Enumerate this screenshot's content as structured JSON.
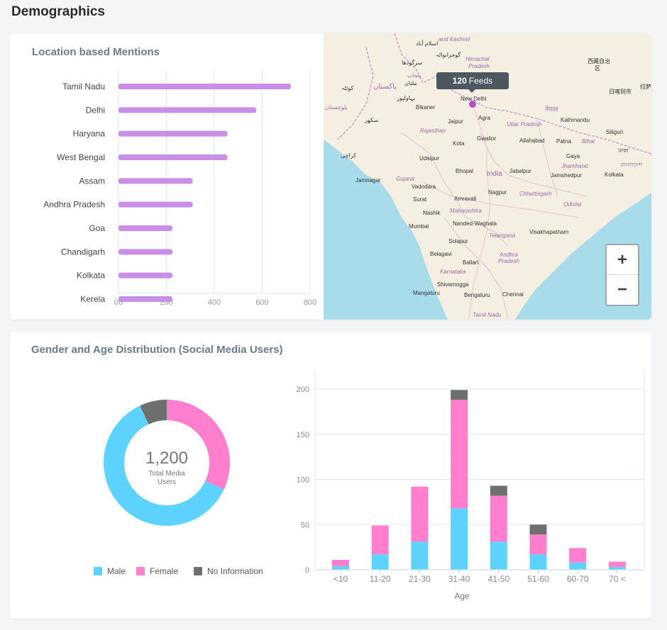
{
  "page": {
    "title": "Demographics"
  },
  "location_card": {
    "title": "Location based Mentions",
    "chart_data": {
      "type": "bar",
      "orientation": "horizontal",
      "categories": [
        "Tamil Nadu",
        "Delhi",
        "Haryana",
        "West Bengal",
        "Assam",
        "Andhra Pradesh",
        "Goa",
        "Chandigarh",
        "Kolkata",
        "Kerela"
      ],
      "values": [
        720,
        575,
        455,
        455,
        310,
        310,
        225,
        225,
        225,
        225
      ],
      "xlim": [
        0,
        800
      ],
      "xticks": [
        "00",
        "200",
        "400",
        "600",
        "800"
      ],
      "bar_color": "#c98ee8",
      "grid": true
    }
  },
  "map": {
    "tooltip_value": "120",
    "tooltip_label": "Feeds",
    "zoom_in_label": "+",
    "zoom_out_label": "−",
    "labels": {
      "new_delhi": "New Delhi",
      "bikaner": "Bikaner",
      "jaipur": "Jaipur",
      "agra": "Agra",
      "uttar_pradesh": "Uttar Pradesh",
      "kathmandu": "Kathmandu",
      "nepal": "नेपाल",
      "siliguri": "Siliguri",
      "rajasthan": "Rajasthan",
      "kota": "Kota",
      "gwalior": "Gwalior",
      "allahabad": "Allahabad",
      "patna": "Patna",
      "bihar": "Bihar",
      "udaipur": "Udaipur",
      "bhopal": "Bhopal",
      "india": "India",
      "jabalpur": "Jabalpur",
      "jamshedpur": "Jamshedpur",
      "kolkata": "Kolkata",
      "jamnagar": "Jamnagar",
      "gujarat": "Gujarat",
      "vadodara": "Vadodara",
      "surat": "Surat",
      "amravati": "Amravati",
      "nagpur": "Nagpur",
      "chhattisgarh": "Chhattisgarh",
      "odisha": "Odisha",
      "nashik": "Nashik",
      "maharashtra": "Maharashtra",
      "mumbai": "Mumbai",
      "nanded": "Nanded-Waghala",
      "telangana": "Telangana",
      "visakhapatnam": "Visakhapatnam",
      "solapur": "Solapur",
      "belagavi": "Belagavi",
      "andhra": "Andhra",
      "pradesh": "Pradesh",
      "ballari": "Ballari",
      "karnataka": "Karnataka",
      "shivamogga": "Shivamogga",
      "mangaluru": "Mangaluru",
      "bengaluru": "Bengaluru",
      "chennai": "Chennai",
      "tamil_nadu": "Tamil Nadu",
      "gaya": "Gaya",
      "jharkhand": "Jharkhand",
      "jammu_kashmir": "and Kashmir",
      "himachal": "Himachal",
      "pradesh2": "Pradesh",
      "xizang": "西藏自治",
      "xizang2": "区",
      "nihon": "日喀则市",
      "lasa": "拉萨",
      "pakistan": "پاکستان",
      "punjab": "پنجاب",
      "islamabad": "اسلام آباد",
      "sargodha": "سرگودھا",
      "multan": "ملتان",
      "quetta": "کوئٹہ",
      "bahawalpur": "بہاولپور",
      "balochistan": "بلوچستان",
      "sukkur": "سکھر",
      "karachi": "کراچی",
      "gujranwala": "گوجرانوالہ",
      "bangladesh": "বাংলাদেশ",
      "nepali2": "ঢাকা"
    }
  },
  "gender_card": {
    "title": "Gender and Age Distribution (Social Media Users)",
    "donut": {
      "total": "1,200",
      "total_label_line1": "Total Media",
      "total_label_line2": "Users",
      "chart_data": {
        "type": "pie",
        "slices": [
          {
            "name": "Male",
            "value": 61,
            "color": "#5fd3ff"
          },
          {
            "name": "Female",
            "value": 32,
            "color": "#ff7fcc"
          },
          {
            "name": "No Information",
            "value": 7,
            "color": "#6f6f6f"
          }
        ]
      }
    },
    "legend": [
      {
        "label": "Male",
        "color": "#5fd3ff"
      },
      {
        "label": "Female",
        "color": "#ff7fcc"
      },
      {
        "label": "No Information",
        "color": "#6f6f6f"
      }
    ],
    "chart_data": {
      "type": "bar",
      "stacked": true,
      "categories": [
        "<10",
        "11-20",
        "21-30",
        "31-40",
        "41-50",
        "51-60",
        "60-70",
        "70 <"
      ],
      "series": [
        {
          "name": "Male",
          "color": "#5fd3ff",
          "values": [
            4,
            17,
            31,
            68,
            31,
            17,
            8,
            3
          ]
        },
        {
          "name": "Female",
          "color": "#ff7fcc",
          "values": [
            7,
            32,
            61,
            120,
            51,
            22,
            16,
            6
          ]
        },
        {
          "name": "No Information",
          "color": "#6f6f6f",
          "values": [
            0,
            0,
            0,
            11,
            11,
            11,
            0,
            0
          ]
        }
      ],
      "ylim": [
        0,
        200
      ],
      "yticks": [
        "0",
        "50",
        "100",
        "150",
        "200"
      ],
      "xlabel": "Age",
      "grid": true
    }
  }
}
